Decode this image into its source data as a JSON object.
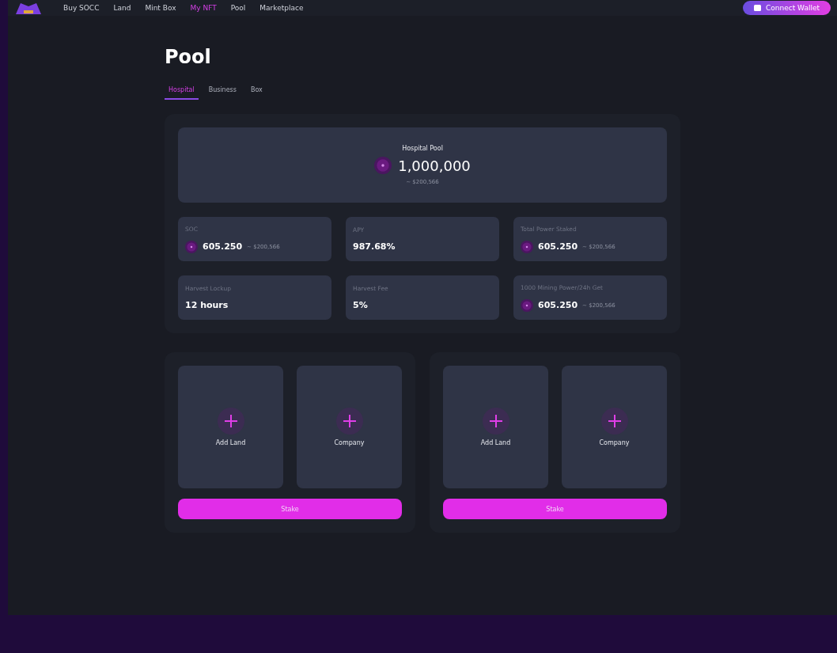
{
  "nav": {
    "items": [
      {
        "label": "Buy SOCC",
        "selected": false
      },
      {
        "label": "Land",
        "selected": false
      },
      {
        "label": "Mint Box",
        "selected": false
      },
      {
        "label": "My NFT",
        "selected": true
      },
      {
        "label": "Pool",
        "selected": false
      },
      {
        "label": "Marketplace",
        "selected": false
      }
    ],
    "connect_button": "Connect Wallet"
  },
  "title": "Pool",
  "tabs": [
    {
      "label": "Hospital",
      "selected": true
    },
    {
      "label": "Business",
      "selected": false
    },
    {
      "label": "Box",
      "selected": false
    }
  ],
  "pool": {
    "title": "Hospital Pool",
    "amount": "1,000,000",
    "usd": "~ $200,566"
  },
  "stats": [
    {
      "label": "SOC",
      "value": "605.250",
      "usd": "~ $200,566",
      "coin": true
    },
    {
      "label": "APY",
      "value": "987.68%",
      "coin": false
    },
    {
      "label": "Total Power Staked",
      "value": "605.250",
      "usd": "~ $200,566",
      "coin": true
    },
    {
      "label": "Harvest Lockup",
      "value": "12 hours",
      "coin": false
    },
    {
      "label": "Harvest Fee",
      "value": "5%",
      "coin": false
    },
    {
      "label": "1000 Mining Power/24h Get",
      "value": "605.250",
      "usd": "~ $200,566",
      "coin": true
    }
  ],
  "stake_panels": [
    {
      "slots": [
        "Add Land",
        "Company"
      ],
      "button": "Stake"
    },
    {
      "slots": [
        "Add Land",
        "Company"
      ],
      "button": "Stake"
    }
  ]
}
